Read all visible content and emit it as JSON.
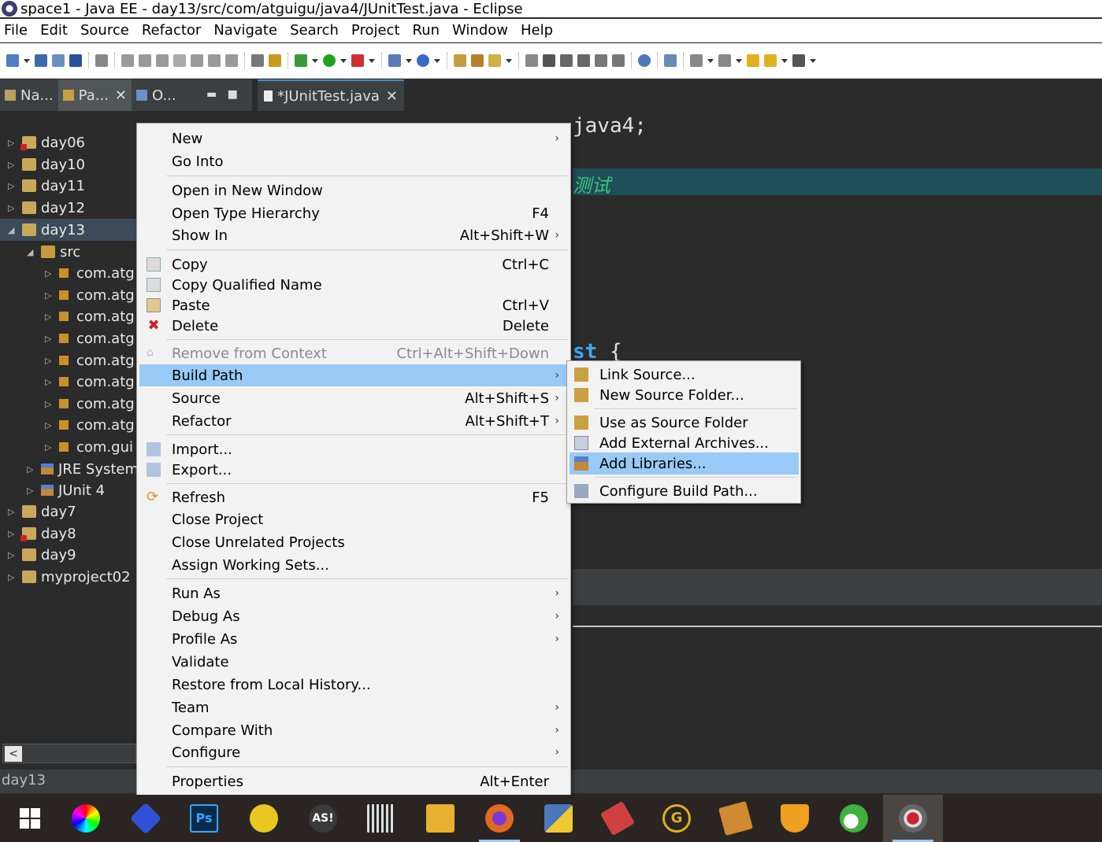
{
  "window": {
    "title": "space1 - Java EE - day13/src/com/atguigu/java4/JUnitTest.java - Eclipse"
  },
  "menubar": [
    "File",
    "Edit",
    "Source",
    "Refactor",
    "Navigate",
    "Search",
    "Project",
    "Run",
    "Window",
    "Help"
  ],
  "left_tabs": [
    {
      "label": "Na...",
      "closable": false
    },
    {
      "label": "Pa...",
      "closable": true
    },
    {
      "label": "O...",
      "closable": false
    }
  ],
  "tree": [
    {
      "label": "day06",
      "level": 0,
      "error": true
    },
    {
      "label": "day10",
      "level": 0
    },
    {
      "label": "day11",
      "level": 0
    },
    {
      "label": "day12",
      "level": 0
    },
    {
      "label": "day13",
      "level": 0,
      "expanded": true,
      "selected": true
    },
    {
      "label": "src",
      "level": 1,
      "expanded": true
    },
    {
      "label": "com.atg",
      "level": 2
    },
    {
      "label": "com.atg",
      "level": 2
    },
    {
      "label": "com.atg",
      "level": 2
    },
    {
      "label": "com.atg",
      "level": 2
    },
    {
      "label": "com.atg",
      "level": 2
    },
    {
      "label": "com.atg",
      "level": 2
    },
    {
      "label": "com.atg",
      "level": 2
    },
    {
      "label": "com.atg",
      "level": 2
    },
    {
      "label": "com.gui",
      "level": 2
    },
    {
      "label": "JRE System",
      "level": 1
    },
    {
      "label": "JUnit 4",
      "level": 1
    },
    {
      "label": "day7",
      "level": 0
    },
    {
      "label": "day8",
      "level": 0,
      "error": true
    },
    {
      "label": "day9",
      "level": 0
    },
    {
      "label": "myproject02",
      "level": 0
    }
  ],
  "status_text": "day13",
  "editor": {
    "tab_label": "*JUnitTest.java",
    "line1_visible": "java4;",
    "comment_visible": "测试",
    "code_fragment_kw": "st",
    "code_fragment_rest": " {"
  },
  "context_menu": [
    {
      "label": "New",
      "submenu": true
    },
    {
      "label": "Go Into"
    },
    {
      "sep": true
    },
    {
      "label": "Open in New Window"
    },
    {
      "label": "Open Type Hierarchy",
      "key": "F4"
    },
    {
      "label": "Show In",
      "key": "Alt+Shift+W",
      "submenu": true
    },
    {
      "sep": true
    },
    {
      "label": "Copy",
      "key": "Ctrl+C",
      "icon": "copy-icon"
    },
    {
      "label": "Copy Qualified Name",
      "icon": "copy-qualified-icon"
    },
    {
      "label": "Paste",
      "key": "Ctrl+V",
      "icon": "paste-icon"
    },
    {
      "label": "Delete",
      "key": "Delete",
      "icon": "delete-icon"
    },
    {
      "sep": true
    },
    {
      "label": "Remove from Context",
      "key": "Ctrl+Alt+Shift+Down",
      "disabled": true,
      "icon": "remove-context-icon"
    },
    {
      "label": "Build Path",
      "submenu": true,
      "highlighted": true
    },
    {
      "label": "Source",
      "key": "Alt+Shift+S",
      "submenu": true
    },
    {
      "label": "Refactor",
      "key": "Alt+Shift+T",
      "submenu": true
    },
    {
      "sep": true
    },
    {
      "label": "Import...",
      "icon": "import-icon"
    },
    {
      "label": "Export...",
      "icon": "export-icon"
    },
    {
      "sep": true
    },
    {
      "label": "Refresh",
      "key": "F5",
      "icon": "refresh-icon"
    },
    {
      "label": "Close Project"
    },
    {
      "label": "Close Unrelated Projects"
    },
    {
      "label": "Assign Working Sets..."
    },
    {
      "sep": true
    },
    {
      "label": "Run As",
      "submenu": true
    },
    {
      "label": "Debug As",
      "submenu": true
    },
    {
      "label": "Profile As",
      "submenu": true
    },
    {
      "label": "Validate"
    },
    {
      "label": "Restore from Local History..."
    },
    {
      "label": "Team",
      "submenu": true
    },
    {
      "label": "Compare With",
      "submenu": true
    },
    {
      "label": "Configure",
      "submenu": true
    },
    {
      "sep": true
    },
    {
      "label": "Properties",
      "key": "Alt+Enter"
    }
  ],
  "build_path_submenu": [
    {
      "label": "Link Source...",
      "icon": "link-source-icon"
    },
    {
      "label": "New Source Folder...",
      "icon": "new-source-folder-icon"
    },
    {
      "sep": true
    },
    {
      "label": "Use as Source Folder",
      "icon": "use-source-folder-icon"
    },
    {
      "label": "Add External Archives...",
      "icon": "add-archive-icon"
    },
    {
      "label": "Add Libraries...",
      "icon": "add-library-icon",
      "highlighted": true
    },
    {
      "sep": true
    },
    {
      "label": "Configure Build Path...",
      "icon": "configure-build-path-icon"
    }
  ],
  "taskbar": [
    {
      "name": "start-button"
    },
    {
      "name": "app-color-picker",
      "color": "#7a2ad0"
    },
    {
      "name": "app-blue-cube",
      "color": "#3050d8"
    },
    {
      "name": "app-photoshop",
      "color": "#0b2a4a"
    },
    {
      "name": "app-yellow-leaf",
      "color": "#e8c820"
    },
    {
      "name": "app-as",
      "color": "#3a3a3a"
    },
    {
      "name": "app-video",
      "color": "#444"
    },
    {
      "name": "app-file-explorer",
      "color": "#e8b030"
    },
    {
      "name": "app-firefox",
      "color": "#e06a20",
      "open": true
    },
    {
      "name": "app-python",
      "color": "#4a78b8"
    },
    {
      "name": "app-eraser",
      "color": "#d04040"
    },
    {
      "name": "app-g",
      "color": "#e0b020"
    },
    {
      "name": "app-book",
      "color": "#d08a30"
    },
    {
      "name": "app-shield",
      "color": "#f0a020"
    },
    {
      "name": "app-green",
      "color": "#40b040"
    },
    {
      "name": "app-eclipse-javaee",
      "color": "#555",
      "active": true
    }
  ]
}
